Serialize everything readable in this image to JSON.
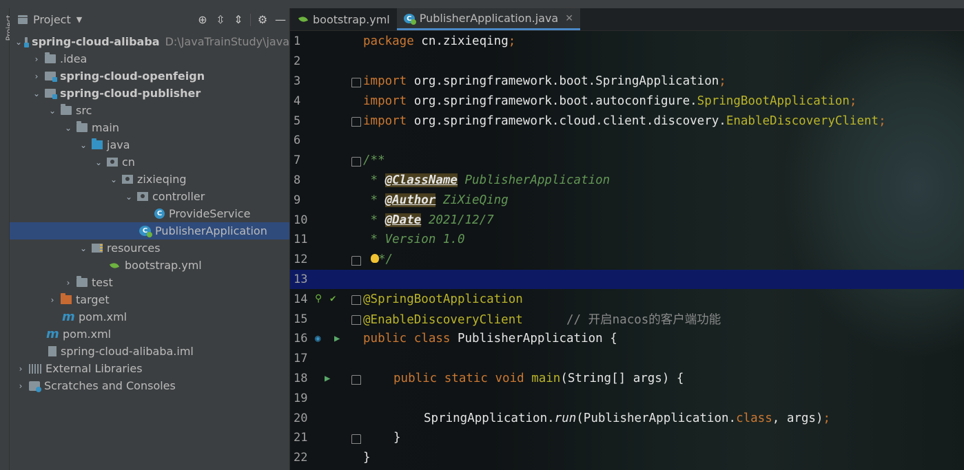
{
  "tool_window": {
    "stripe_label": "Project"
  },
  "project_panel": {
    "title": "Project",
    "tree": [
      {
        "label": "spring-cloud-alibaba",
        "path": "D:\\JavaTrainStudy\\java",
        "depth": 0,
        "expanded": true,
        "icon": "module-icon"
      },
      {
        "label": ".idea",
        "depth": 1,
        "expanded": false,
        "icon": "folder-icon"
      },
      {
        "label": "spring-cloud-openfeign",
        "depth": 1,
        "expanded": false,
        "icon": "module-icon"
      },
      {
        "label": "spring-cloud-publisher",
        "depth": 1,
        "expanded": true,
        "icon": "module-icon"
      },
      {
        "label": "src",
        "depth": 2,
        "expanded": true,
        "icon": "folder-icon"
      },
      {
        "label": "main",
        "depth": 3,
        "expanded": true,
        "icon": "folder-icon"
      },
      {
        "label": "java",
        "depth": 4,
        "expanded": true,
        "icon": "source-folder-icon"
      },
      {
        "label": "cn",
        "depth": 5,
        "expanded": true,
        "icon": "package-icon"
      },
      {
        "label": "zixieqing",
        "depth": 6,
        "expanded": true,
        "icon": "package-icon"
      },
      {
        "label": "controller",
        "depth": 7,
        "expanded": true,
        "icon": "package-icon"
      },
      {
        "label": "ProvideService",
        "depth": 8,
        "icon": "class-icon"
      },
      {
        "label": "PublisherApplication",
        "depth": 8,
        "icon": "spring-boot-class-icon",
        "selected": true
      },
      {
        "label": "resources",
        "depth": 4,
        "expanded": true,
        "icon": "resources-folder-icon"
      },
      {
        "label": "bootstrap.yml",
        "depth": 5,
        "icon": "spring-yml-icon"
      },
      {
        "label": "test",
        "depth": 3,
        "expanded": false,
        "icon": "folder-icon"
      },
      {
        "label": "target",
        "depth": 2,
        "expanded": false,
        "icon": "target-folder-icon"
      },
      {
        "label": "pom.xml",
        "depth": 2,
        "icon": "maven-icon"
      },
      {
        "label": "pom.xml",
        "depth": 1,
        "icon": "maven-icon"
      },
      {
        "label": "spring-cloud-alibaba.iml",
        "depth": 1,
        "icon": "iml-file-icon"
      },
      {
        "label": "External Libraries",
        "depth": 0,
        "expanded": false,
        "icon": "libraries-icon"
      },
      {
        "label": "Scratches and Consoles",
        "depth": 0,
        "expanded": false,
        "icon": "scratches-icon"
      }
    ]
  },
  "editor": {
    "tabs": [
      {
        "label": "bootstrap.yml",
        "active": false
      },
      {
        "label": "PublisherApplication.java",
        "active": true
      }
    ],
    "line_numbers": [
      "1",
      "2",
      "3",
      "4",
      "5",
      "6",
      "7",
      "8",
      "9",
      "10",
      "11",
      "12",
      "13",
      "14",
      "15",
      "16",
      "17",
      "18",
      "19",
      "20",
      "21",
      "22"
    ],
    "code": {
      "l1": {
        "kw": "package",
        "rest": " cn.zixieqing",
        "semi": ";"
      },
      "l3": {
        "kw": "import",
        "rest": " org.springframework.boot.SpringApplication",
        "semi": ";"
      },
      "l4": {
        "kw": "import",
        "rest": " org.springframework.boot.autoconfigure.",
        "cls": "SpringBootApplication",
        "semi": ";"
      },
      "l5": {
        "kw": "import",
        "rest": " org.springframework.cloud.client.discovery.",
        "cls": "EnableDiscoveryClient",
        "semi": ";"
      },
      "l7": "/**",
      "l8": {
        "star": " * ",
        "tag": "@ClassName",
        "val": " PublisherApplication"
      },
      "l9": {
        "star": " * ",
        "tag": "@Author",
        "val": " ZiXieQing"
      },
      "l10": {
        "star": " * ",
        "tag": "@Date",
        "val": " 2021/12/7"
      },
      "l11": " * Version 1.0",
      "l12": "*/",
      "l14": "@SpringBootApplication",
      "l15": {
        "ann": "@EnableDiscoveryClient",
        "comment": "// 开启nacos的客户端功能"
      },
      "l16": {
        "kw": "public class",
        "rest": " PublisherApplication {"
      },
      "l18": {
        "kw": "public static void",
        "fn": " main",
        "rest": "(String[] args) {"
      },
      "l20": {
        "a": "SpringApplication.",
        "m": "run",
        "b": "(PublisherApplication.",
        "kw": "class",
        "c": ", args)",
        "semi": ";"
      },
      "l21": "}",
      "l22": "}"
    }
  },
  "colors": {
    "keyword": "#cc7832",
    "annotation": "#bbb529",
    "doc_comment": "#629755",
    "selection": "#2f4b7c",
    "caret_row": "#0d1a63"
  }
}
